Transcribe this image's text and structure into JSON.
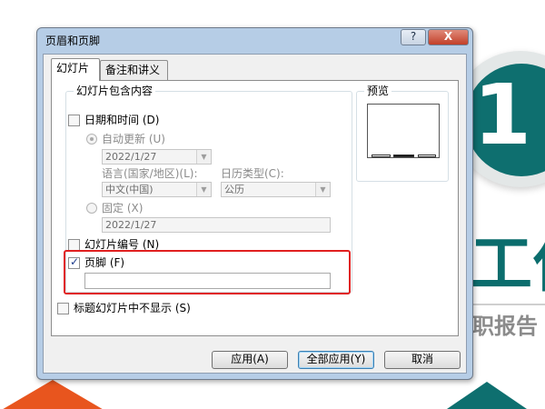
{
  "background": {
    "number": "1",
    "big_text": "工作计",
    "sub_text": "职报告",
    "colors": {
      "teal": "#0e6f6f",
      "orange": "#e8551e"
    }
  },
  "dialog": {
    "title": "页眉和页脚",
    "help_label": "?",
    "close_label": "X",
    "tabs": [
      {
        "label": "幻灯片"
      },
      {
        "label": "备注和讲义"
      }
    ],
    "include_group": {
      "legend": "幻灯片包含内容",
      "date_time": {
        "label": "日期和时间",
        "hotkey": "(D)",
        "checked": false
      },
      "auto_update": {
        "label": "自动更新",
        "hotkey": "(U)",
        "value": "2022/1/27"
      },
      "language": {
        "label": "语言(国家/地区)(L):",
        "value": "中文(中国)"
      },
      "calendar": {
        "label": "日历类型(C):",
        "value": "公历"
      },
      "fixed": {
        "label": "固定",
        "hotkey": "(X)",
        "value": "2022/1/27"
      },
      "slide_number": {
        "label": "幻灯片编号",
        "hotkey": "(N)",
        "checked": false
      },
      "footer": {
        "label": "页脚",
        "hotkey": "(F)",
        "checked": true,
        "value": ""
      }
    },
    "no_title_slide": {
      "label": "标题幻灯片中不显示",
      "hotkey": "(S)",
      "checked": false
    },
    "preview": {
      "legend": "预览"
    },
    "buttons": {
      "apply": "应用(A)",
      "apply_all": "全部应用(Y)",
      "cancel": "取消"
    }
  }
}
